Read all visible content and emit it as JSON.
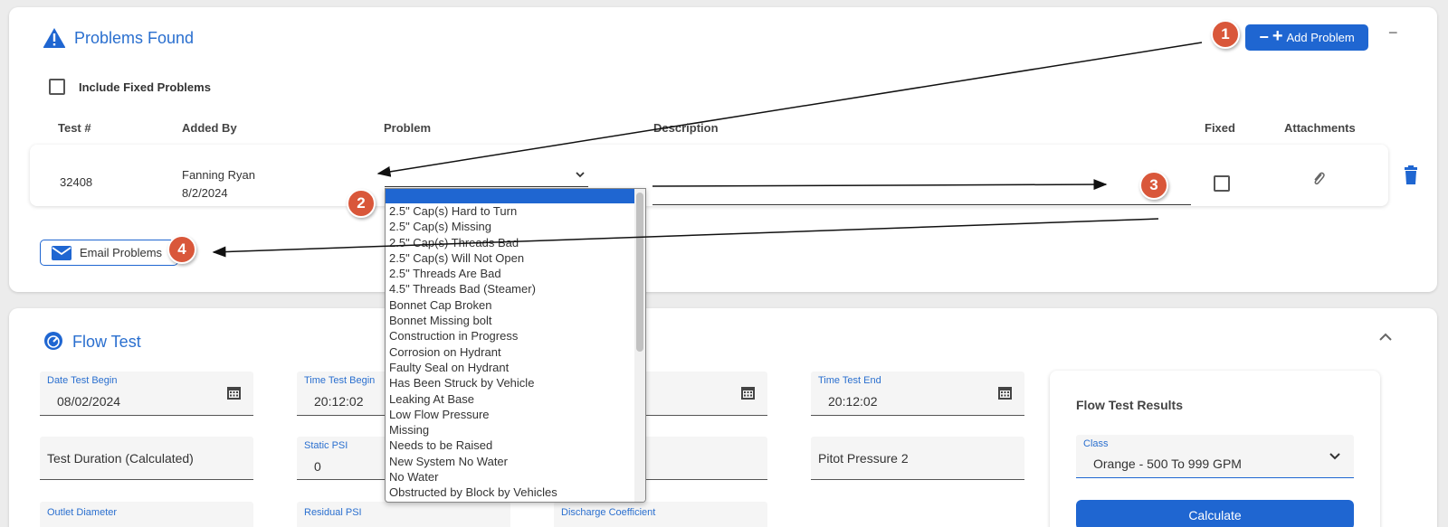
{
  "problems": {
    "title": "Problems Found",
    "add_button": "Add Problem",
    "collapse": "−",
    "include_fixed_label": "Include Fixed Problems",
    "columns": [
      "Test #",
      "Added By",
      "Problem",
      "Description",
      "Fixed",
      "Attachments"
    ],
    "row": {
      "test_number": "32408",
      "added_by_name": "Fanning Ryan",
      "added_by_date": "8/2/2024",
      "problem_value": "",
      "description_value": "",
      "fixed": false
    },
    "email_button": "Email Problems"
  },
  "problem_options": [
    "2.5\" Cap(s) Hard to Turn",
    "2.5\" Cap(s) Missing",
    "2.5\" Cap(s) Threads Bad",
    "2.5\" Cap(s) Will Not Open",
    "2.5\" Threads Are Bad",
    "4.5\" Threads Bad (Steamer)",
    "Bonnet Cap Broken",
    "Bonnet Missing bolt",
    "Construction in Progress",
    "Corrosion on Hydrant",
    "Faulty Seal on Hydrant",
    "Has Been Struck by Vehicle",
    "Leaking At Base",
    "Low Flow Pressure",
    "Missing",
    "Needs to be Raised",
    "New System No Water",
    "No Water",
    "Obstructed by Block by Vehicles"
  ],
  "badges": [
    "1",
    "2",
    "3",
    "4"
  ],
  "flow_test": {
    "title": "Flow Test",
    "date_begin": {
      "label": "Date Test Begin",
      "value": "08/02/2024"
    },
    "time_begin": {
      "label": "Time Test Begin",
      "value": "20:12:02"
    },
    "time_end": {
      "label": "Time Test End",
      "value": "20:12:02"
    },
    "duration_placeholder": "Test Duration (Calculated)",
    "static_psi": {
      "label": "Static PSI",
      "value": "0"
    },
    "pitot2_placeholder": "Pitot Pressure 2",
    "outlet_label": "Outlet Diameter",
    "residual_label": "Residual PSI",
    "discharge_label": "Discharge Coefficient",
    "results": {
      "title": "Flow Test Results",
      "class_label": "Class",
      "class_value": "Orange - 500 To 999 GPM",
      "calculate": "Calculate"
    }
  },
  "colors": {
    "accent": "#1f66d1",
    "title": "#2a6fcf",
    "badge": "#d9573a",
    "danger": "#1f66d1"
  }
}
